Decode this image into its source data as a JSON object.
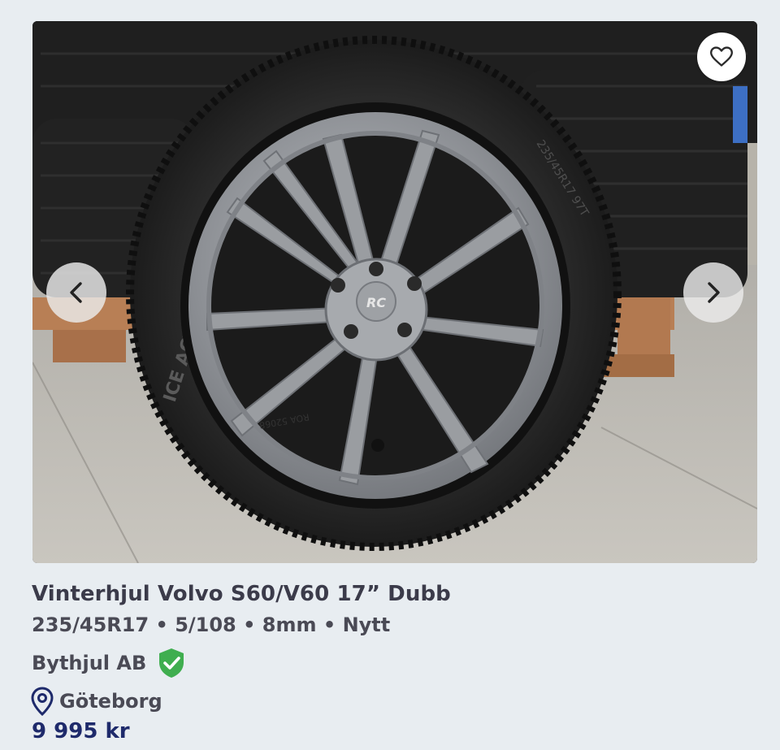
{
  "listing": {
    "title": "Vinterhjul Volvo S60/V60 17” Dubb",
    "specs": "235/45R17 • 5/108 • 8mm • Nytt",
    "seller": "Bythjul AB",
    "location": "Göteborg",
    "price": "9 995 kr"
  },
  "image": {
    "tire_text": "ICE ACTIVA",
    "wheel_logo": "RC",
    "tire_size_marking": "235/45R17 97T",
    "rim_marking": "ROA 52068"
  },
  "icons": {
    "favorite": "heart-outline-icon",
    "prev": "chevron-left-icon",
    "next": "chevron-right-icon",
    "verified": "shield-check-icon",
    "location": "map-pin-icon"
  },
  "colors": {
    "background": "#e8edf1",
    "text": "#4a4a55",
    "price": "#1e2a6b",
    "verified": "#3fae4f",
    "location_pin": "#1e2a6b"
  }
}
